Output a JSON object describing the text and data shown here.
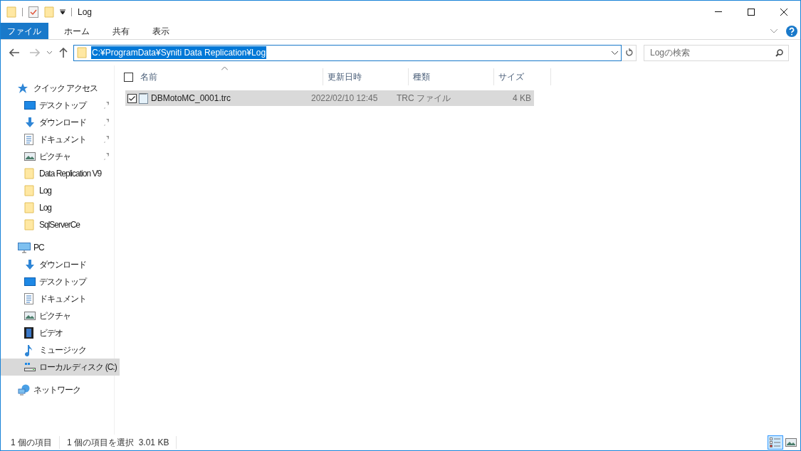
{
  "title_bar": {
    "title": "Log"
  },
  "ribbon": {
    "tabs": [
      {
        "label": "ファイル",
        "selected": true
      },
      {
        "label": "ホーム",
        "selected": false
      },
      {
        "label": "共有",
        "selected": false
      },
      {
        "label": "表示",
        "selected": false
      }
    ]
  },
  "address_bar": {
    "path": "C:¥ProgramData¥Syniti Data Replication¥Log",
    "highlighted": true
  },
  "search": {
    "placeholder": "Logの検索"
  },
  "nav": [
    {
      "label": "クイック アクセス",
      "kind": "star",
      "items": [
        {
          "label": "デスクトップ",
          "kind": "desktop",
          "pinned": true,
          "selected": false
        },
        {
          "label": "ダウンロード",
          "kind": "download",
          "pinned": true,
          "selected": false
        },
        {
          "label": "ドキュメント",
          "kind": "document",
          "pinned": true,
          "selected": false
        },
        {
          "label": "ピクチャ",
          "kind": "picture",
          "pinned": true,
          "selected": false
        },
        {
          "label": "Data Replication V9",
          "kind": "folder",
          "pinned": false,
          "selected": false
        },
        {
          "label": "Log",
          "kind": "folder",
          "pinned": false,
          "selected": false
        },
        {
          "label": "Log",
          "kind": "folder",
          "pinned": false,
          "selected": false
        },
        {
          "label": "SqlServerCe",
          "kind": "folder",
          "pinned": false,
          "selected": false
        }
      ]
    },
    {
      "label": "PC",
      "kind": "pc",
      "items": [
        {
          "label": "ダウンロード",
          "kind": "download",
          "pinned": false,
          "selected": false
        },
        {
          "label": "デスクトップ",
          "kind": "desktop",
          "pinned": false,
          "selected": false
        },
        {
          "label": "ドキュメント",
          "kind": "document",
          "pinned": false,
          "selected": false
        },
        {
          "label": "ピクチャ",
          "kind": "picture",
          "pinned": false,
          "selected": false
        },
        {
          "label": "ビデオ",
          "kind": "video",
          "pinned": false,
          "selected": false
        },
        {
          "label": "ミュージック",
          "kind": "music",
          "pinned": false,
          "selected": false
        },
        {
          "label": "ローカル ディスク (C:)",
          "kind": "drive",
          "pinned": false,
          "selected": true
        }
      ]
    },
    {
      "label": "ネットワーク",
      "kind": "network"
    }
  ],
  "select_all": {
    "checked": false
  },
  "columns": [
    {
      "label": "名前",
      "sorted": true
    },
    {
      "label": "更新日時",
      "sorted": false
    },
    {
      "label": "種類",
      "sorted": false
    },
    {
      "label": "サイズ",
      "sorted": false
    }
  ],
  "rows": [
    {
      "name": "DBMotoMC_0001.trc",
      "modified": "2022/02/10 12:45",
      "type": "TRC ファイル",
      "size": "4 KB",
      "checked": true,
      "selected": true
    }
  ],
  "status_bar": {
    "item_count": "1 個の項目",
    "selection": "1 個の項目を選択  3.01 KB"
  },
  "view_buttons": [
    {
      "kind": "details",
      "selected": true
    },
    {
      "kind": "large_icons",
      "selected": false
    }
  ]
}
